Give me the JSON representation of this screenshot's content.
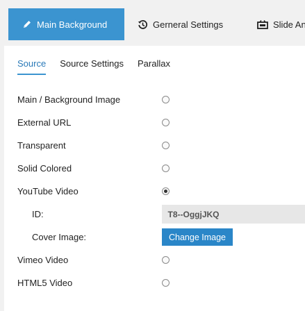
{
  "top_tabs": [
    {
      "label": "Main Background",
      "icon": "pencil-icon",
      "active": true
    },
    {
      "label": "Gerneral Settings",
      "icon": "history-icon",
      "active": false
    },
    {
      "label": "Slide An",
      "icon": "slideshow-icon",
      "active": false
    }
  ],
  "sub_tabs": [
    {
      "label": "Source",
      "active": true
    },
    {
      "label": "Source Settings",
      "active": false
    },
    {
      "label": "Parallax",
      "active": false
    }
  ],
  "options": {
    "main_bg_image": "Main / Background Image",
    "external_url": "External URL",
    "transparent": "Transparent",
    "solid_colored": "Solid Colored",
    "youtube_video": "YouTube Video",
    "id_label": "ID:",
    "id_value": "T8--OggjJKQ",
    "cover_image_label": "Cover Image:",
    "change_image_label": "Change Image",
    "vimeo_video": "Vimeo Video",
    "html5_video": "HTML5 Video"
  },
  "selected_option": "youtube_video",
  "colors": {
    "accent": "#3b94d0",
    "button": "#2a86c8",
    "background": "#f1f1f1"
  }
}
